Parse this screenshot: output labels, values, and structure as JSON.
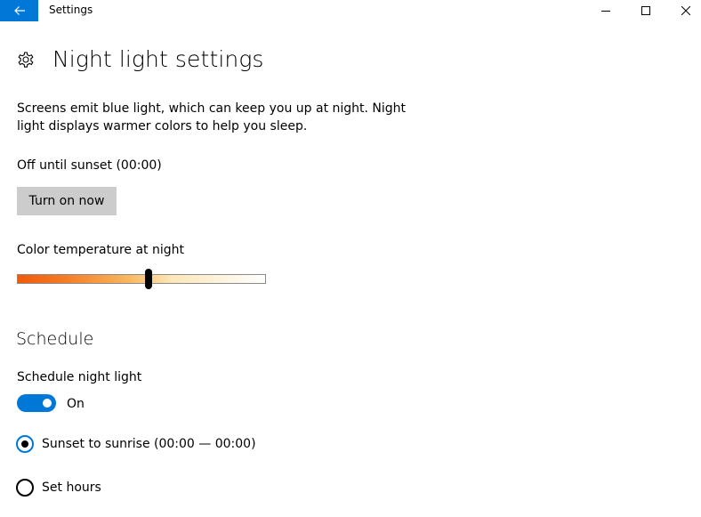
{
  "window": {
    "app_title": "Settings"
  },
  "header": {
    "icon": "gear-icon",
    "title": "Night light settings"
  },
  "description": "Screens emit blue light, which can keep you up at night. Night light displays warmer colors to help you sleep.",
  "status_text": "Off until sunset (00:00)",
  "turn_on_button": "Turn on now",
  "color_temperature": {
    "label": "Color temperature at night",
    "value_fraction": 0.53
  },
  "schedule": {
    "heading": "Schedule",
    "toggle_label": "Schedule night light",
    "toggle_on": true,
    "toggle_state": "On",
    "options": [
      {
        "label": "Sunset to sunrise (00:00 — 00:00)",
        "selected": true
      },
      {
        "label": "Set hours",
        "selected": false
      }
    ]
  },
  "colors": {
    "accent": "#0078d7",
    "button_bg": "#cccccc"
  }
}
